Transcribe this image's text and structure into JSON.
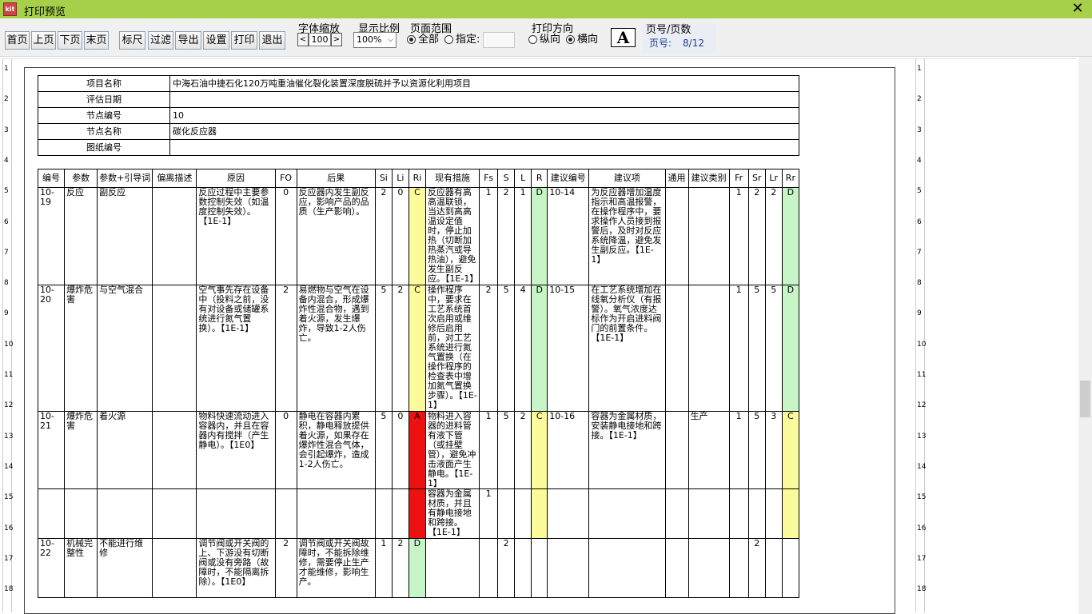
{
  "window": {
    "title": "打印预览",
    "icon_text": "kit"
  },
  "toolbar": {
    "nav": [
      "首页",
      "上页",
      "下页",
      "末页"
    ],
    "actions": [
      "标尺",
      "过滤",
      "导出",
      "设置",
      "打印",
      "退出"
    ],
    "font_zoom": {
      "label": "字体缩放",
      "value": "100",
      "dec": "<",
      "inc": ">"
    },
    "display_ratio": {
      "label": "显示比例",
      "value": "100%"
    },
    "page_range": {
      "label": "页面范围",
      "all": "全部",
      "specify": "指定:"
    },
    "orientation": {
      "label": "打印方向",
      "portrait": "纵向",
      "landscape": "横向"
    },
    "font_button": "A",
    "page_info": {
      "label": "页号/页数",
      "key": "页号:",
      "value": "8/12"
    }
  },
  "colors": {
    "title_bar": "#a6d04a",
    "yellow": "#fbfb9b",
    "green": "#c8f5c8",
    "red": "#ee1111"
  },
  "ruler_numbers": [
    "1",
    "2",
    "3",
    "4",
    "5",
    "6",
    "7",
    "8",
    "9",
    "10",
    "11",
    "12",
    "13",
    "14",
    "15",
    "16",
    "17",
    "18"
  ],
  "info": [
    {
      "label": "项目名称",
      "value": "中海石油中捷石化120万吨重油催化裂化装置深度脱硫并予以资源化利用项目"
    },
    {
      "label": "评估日期",
      "value": ""
    },
    {
      "label": "节点编号",
      "value": "10"
    },
    {
      "label": "节点名称",
      "value": "碳化反应器"
    },
    {
      "label": "图纸编号",
      "value": ""
    }
  ],
  "headers": [
    "编号",
    "参数",
    "参数+引导词",
    "偏离描述",
    "原因",
    "FO",
    "后果",
    "Si",
    "Li",
    "Ri",
    "现有措施",
    "Fs",
    "S",
    "L",
    "R",
    "建议编号",
    "建议项",
    "通用",
    "建议类别",
    "Fr",
    "Sr",
    "Lr",
    "Rr"
  ],
  "rows": [
    {
      "no": "10-19",
      "param": "反应",
      "guide": "副反应",
      "dev": "",
      "cause": "反应过程中主要参数控制失效（如温度控制失效）。【1E-1】",
      "fo": "0",
      "cons": "反应器内发生副反应，影响产品的品质（生产影响）。",
      "si": "2",
      "li": "0",
      "ri": "C",
      "measure": "反应器有高高温联锁，当达到高高温设定值时，停止加热（切断加热蒸汽或导热油），避免发生副反应。【1E-1】",
      "fs": "1",
      "s": "2",
      "l": "1",
      "r": "D",
      "sug_no": "10-14",
      "sug": "为反应器增加温度指示和高温报警，在操作程序中，要求操作人员接到报警后，及时对反应系统降温，避免发生副反应。【1E-1】",
      "gen": "",
      "cat": "",
      "fr": "1",
      "sr": "2",
      "lr": "2",
      "rr": "D"
    },
    {
      "no": "10-20",
      "param": "爆炸危害",
      "guide": "与空气混合",
      "dev": "",
      "cause": "空气事先存在设备中（投料之前，没有对设备或储罐系统进行氮气置换）。【1E-1】",
      "fo": "2",
      "cons": "易燃物与空气在设备内混合，形成爆炸性混合物，遇到着火源，发生爆炸，导致1-2人伤亡。",
      "si": "5",
      "li": "2",
      "ri": "C",
      "measure": "操作程序中，要求在工艺系统首次启用或维修后启用前，对工艺系统进行氮气置换（在操作程序的检查表中增加氮气置换步骤）。【1E-1】",
      "fs": "2",
      "s": "5",
      "l": "4",
      "r": "D",
      "sug_no": "10-15",
      "sug": "在工艺系统增加在线氧分析仪（有报警）。氧气浓度达标作为开启进料阀门的前置条件。【1E-1】",
      "gen": "",
      "cat": "",
      "fr": "1",
      "sr": "5",
      "lr": "5",
      "rr": "D"
    },
    {
      "no": "10-21",
      "param": "爆炸危害",
      "guide": "着火源",
      "dev": "",
      "cause": "物料快速流动进入容器内，并且在容器内有搅拌（产生静电）。【1E0】",
      "fo": "0",
      "cons": "静电在容器内累积，静电释放提供着火源，如果存在爆炸性混合气体，会引起爆炸，造成1-2人伤亡。",
      "si": "5",
      "li": "0",
      "ri": "A",
      "measure": "物料进入容器的进料管有液下管（或挂壁管），避免冲击液面产生静电。【1E-1】",
      "fs": "1",
      "s": "5",
      "l": "2",
      "r": "C",
      "sug_no": "10-16",
      "sug": "容器为金属材质，安装静电接地和跨接。【1E-1】",
      "gen": "",
      "cat": "生产",
      "fr": "1",
      "sr": "5",
      "lr": "3",
      "rr": "C"
    },
    {
      "measure": "容器为金属材质，并且有静电接地和跨接。【1E-1】",
      "fs": "1"
    },
    {
      "no": "10-22",
      "param": "机械完整性",
      "guide": "不能进行维修",
      "dev": "",
      "cause": "调节阀或开关阀的上、下游没有切断阀或没有旁路（故障时，不能隔离拆除）。【1E0】",
      "fo": "2",
      "cons": "调节阀或开关阀故障时，不能拆除维修，需要停止生产才能维修，影响生产。",
      "si": "1",
      "li": "2",
      "ri": "D",
      "measure": "",
      "fs": "",
      "s": "2",
      "l": "",
      "r": "",
      "sug_no": "",
      "sug": "",
      "gen": "",
      "cat": "",
      "fr": "",
      "sr": "2",
      "lr": "",
      "rr": ""
    }
  ]
}
